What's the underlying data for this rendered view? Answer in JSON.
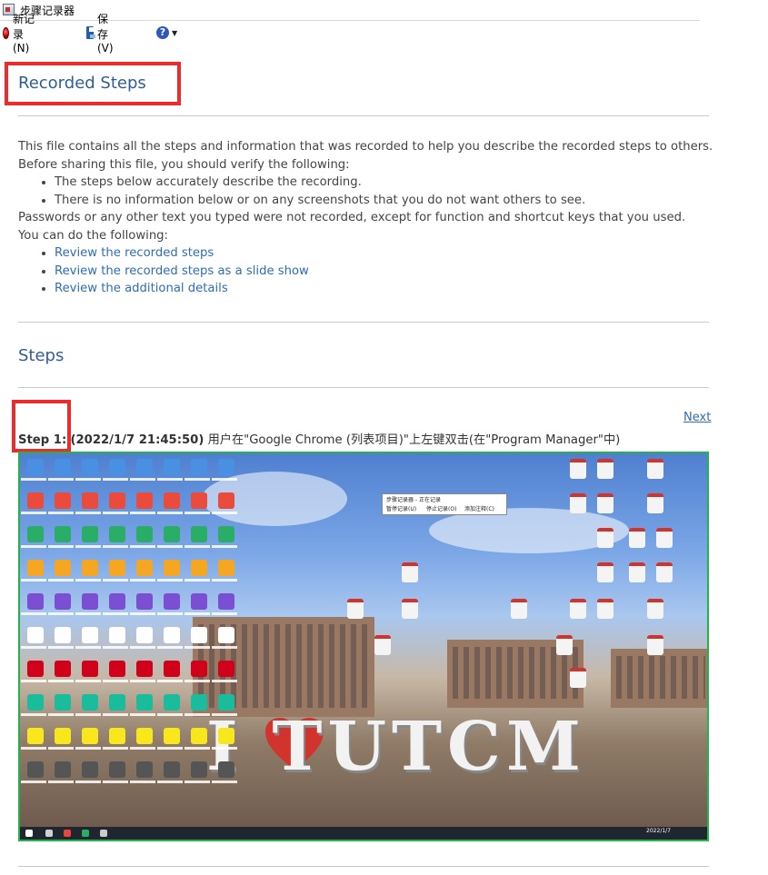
{
  "window": {
    "title": "步骤记录器"
  },
  "toolbar": {
    "new_record": "新记录(N)",
    "save": "保存(V)",
    "help_symbol": "?",
    "dropdown_symbol": "▼"
  },
  "header": {
    "title": "Recorded Steps"
  },
  "intro": {
    "line1": "This file contains all the steps and information that was recorded to help you describe the recorded steps to others.",
    "line2": "Before sharing this file, you should verify the following:",
    "checks": [
      "The steps below accurately describe the recording.",
      "There is no information below or on any screenshots that you do not want others to see."
    ],
    "line3": "Passwords or any other text you typed were not recorded, except for function and shortcut keys that you used.",
    "line4": "You can do the following:",
    "links": [
      "Review the recorded steps",
      "Review the recorded steps as a slide show",
      "Review the additional details"
    ]
  },
  "steps_section": {
    "title": "Steps"
  },
  "step1": {
    "next": "Next",
    "label": "Step 1:",
    "time": "(2022/1/7 21:45:50)",
    "text": "用户在\"Google Chrome (列表项目)\"上左键双击(在\"Program Manager\"中)"
  },
  "screenshot": {
    "slogan": "I TUTCM",
    "window_title": "步骤记录器 - 正在记录",
    "window_buttons": [
      "暂停记录(U)",
      "停止记录(O)",
      "添加注释(C)"
    ],
    "tray_time": "2022/1/7",
    "accent_color": "#23b24c"
  },
  "colors": {
    "heading": "#2f5d9b",
    "link": "#2f6db5",
    "highlight_box": "#ee2b2b"
  }
}
